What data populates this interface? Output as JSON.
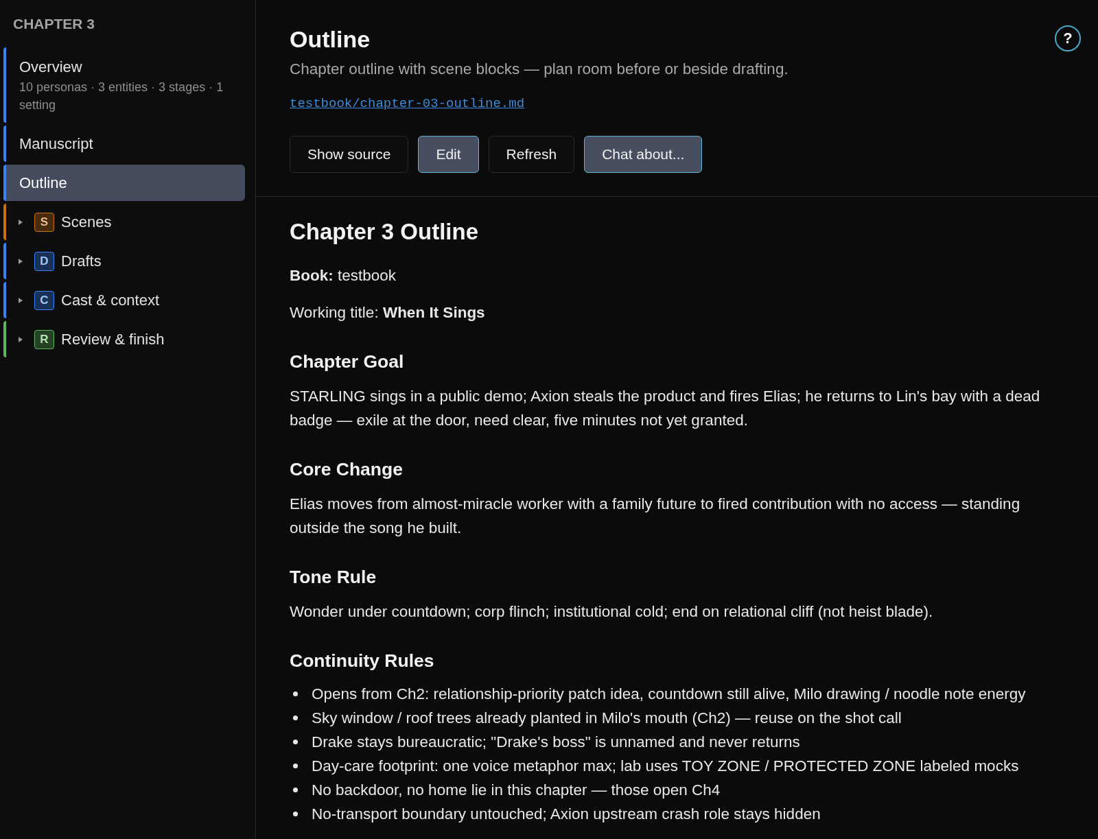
{
  "sidebar": {
    "heading": "CHAPTER 3",
    "items": [
      {
        "kind": "page",
        "label": "Overview",
        "detail": "10 personas · 3 entities · 3 stages · 1 setting",
        "selected": false,
        "color": "#3b82f6"
      },
      {
        "kind": "page",
        "label": "Manuscript",
        "selected": false,
        "color": "#3b82f6"
      },
      {
        "kind": "page",
        "label": "Outline",
        "selected": true,
        "color": "#3b82f6"
      },
      {
        "kind": "group",
        "label": "Scenes",
        "badge": "S",
        "expanded": false,
        "selected": false,
        "color": "#c8700f"
      },
      {
        "kind": "group",
        "label": "Drafts",
        "badge": "D",
        "expanded": false,
        "selected": false,
        "color": "#3b82f6"
      },
      {
        "kind": "group",
        "label": "Cast & context",
        "badge": "C",
        "expanded": false,
        "selected": false,
        "color": "#3b82f6"
      },
      {
        "kind": "group",
        "label": "Review & finish",
        "badge": "R",
        "expanded": false,
        "selected": false,
        "color": "#5cb85c"
      }
    ]
  },
  "header": {
    "title": "Outline",
    "subtitle": "Chapter outline with scene blocks — plan room before or beside drafting.",
    "path": "testbook/chapter-03-outline.md",
    "help": "?",
    "actions": [
      {
        "label": "Show source",
        "active": false
      },
      {
        "label": "Edit",
        "active": true
      },
      {
        "label": "Refresh",
        "active": false
      },
      {
        "label": "Chat about...",
        "active": true
      }
    ]
  },
  "document": {
    "title": "Chapter 3 Outline",
    "meta": [
      "**Book:** testbook",
      "Working title: **When It Sings**"
    ],
    "sections": [
      {
        "kind": "paragraph",
        "heading": "Chapter Goal",
        "text": "STARLING sings in a public demo; Axion steals the product and fires Elias; he returns to Lin's bay with a dead badge — exile at the door, need clear, five minutes not yet granted."
      },
      {
        "kind": "paragraph",
        "heading": "Core Change",
        "text": "Elias moves from almost-miracle worker with a family future to fired contribution with no access — standing outside the song he built."
      },
      {
        "kind": "paragraph",
        "heading": "Tone Rule",
        "text": "Wonder under countdown; corp flinch; institutional cold; end on relational cliff (not heist blade)."
      },
      {
        "kind": "list",
        "heading": "Continuity Rules",
        "items": [
          "Opens from Ch2: relationship-priority patch idea, countdown still alive, Milo drawing / noodle note energy",
          "Sky window / roof trees already planted in Milo's mouth (Ch2) — reuse on the shot call",
          "Drake stays bureaucratic; \"Drake's boss\" is unnamed and never returns",
          "Day-care footprint: one voice metaphor max; lab uses TOY ZONE / PROTECTED ZONE labeled mocks",
          "No backdoor, no home lie in this chapter — those open Ch4",
          "No-transport boundary untouched; Axion upstream crash role stays hidden"
        ]
      }
    ]
  }
}
